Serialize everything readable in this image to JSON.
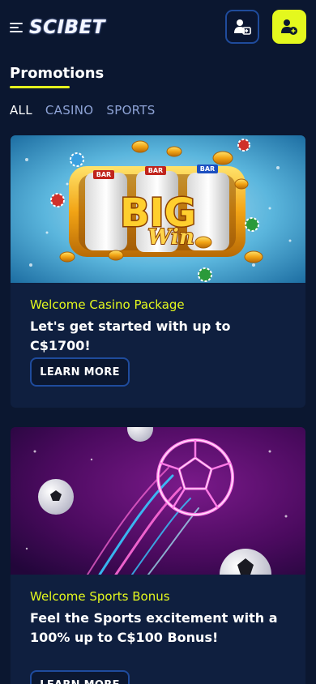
{
  "header": {
    "logo_text": "SCIBET",
    "menu_icon": "hamburger-icon",
    "login_icon": "login-icon",
    "register_icon": "add-user-icon"
  },
  "page": {
    "title": "Promotions"
  },
  "tabs": [
    {
      "label": "ALL",
      "active": true
    },
    {
      "label": "CASINO",
      "active": false
    },
    {
      "label": "SPORTS",
      "active": false
    }
  ],
  "promotions": [
    {
      "banner_text_main": "BIG",
      "banner_text_script": "Win",
      "reel_labels": [
        "BAR",
        "BAR",
        "BAR"
      ],
      "subtitle": "Welcome Casino Package",
      "heading": "Let's get started with up to C$1700!",
      "button_label": "LEARN MORE"
    },
    {
      "subtitle": "Welcome Sports Bonus",
      "heading": "Feel the Sports excitement with a 100% up to C$100 Bonus!",
      "button_label": "LEARN MORE"
    }
  ],
  "colors": {
    "background": "#0b1730",
    "card": "#0f1f3f",
    "accent": "#e4f81e",
    "border": "#1f4b9c",
    "tab_inactive": "#8ea3d6"
  }
}
